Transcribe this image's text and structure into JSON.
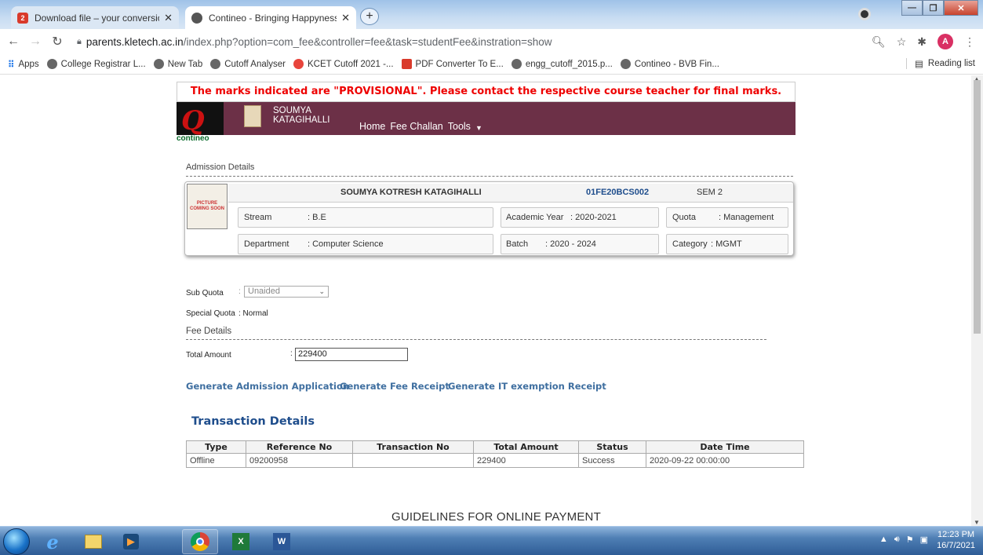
{
  "browser": {
    "tabs": [
      {
        "title": "Download file – your conversion",
        "active": false
      },
      {
        "title": "Contineo - Bringing Happyness t",
        "active": true
      }
    ],
    "url_host": "parents.kletech.ac.in",
    "url_path": "/index.php?option=com_fee&controller=fee&task=studentFee&instration=show",
    "profile_initial": "A",
    "bookmarks": [
      "Apps",
      "College Registrar L...",
      "New Tab",
      "Cutoff Analyser",
      "KCET Cutoff 2021 -...",
      "PDF Converter To E...",
      "engg_cutoff_2015.p...",
      "Contineo - BVB Fin..."
    ],
    "reading_list": "Reading list"
  },
  "page": {
    "notice": "The marks indicated are \"PROVISIONAL\". Please contact the respective course teacher for final marks.",
    "logo_text": "contineo",
    "student_short_name": "SOUMYA KATAGIHALLI",
    "nav": [
      "Home",
      "Fee Challan",
      "Tools"
    ],
    "picture_placeholder": "PICTURE COMING SOON",
    "admission": {
      "section_title": "Admission Details",
      "full_name": "SOUMYA KOTRESH KATAGIHALLI",
      "usn": "01FE20BCS002",
      "semester": "SEM 2",
      "stream_label": "Stream",
      "stream_value": ": B.E",
      "academic_year_label": "Academic Year",
      "academic_year_value": ": 2020-2021",
      "quota_label": "Quota",
      "quota_value": ": Management",
      "department_label": "Department",
      "department_value": ": Computer Science",
      "batch_label": "Batch",
      "batch_value": ": 2020 - 2024",
      "category_label": "Category",
      "category_value": ": MGMT"
    },
    "sub_quota_label": "Sub Quota",
    "sub_quota_value": "Unaided",
    "special_quota_label": "Special Quota",
    "special_quota_value": ": Normal",
    "fee": {
      "section_title": "Fee Details",
      "total_amount_label": "Total Amount",
      "total_amount_value": "229400"
    },
    "links": [
      "Generate Admission Application",
      "Generate Fee Receipt",
      "Generate IT exemption Receipt"
    ],
    "transactions": {
      "title": "Transaction Details",
      "headers": [
        "Type",
        "Reference No",
        "Transaction No",
        "Total Amount",
        "Status",
        "Date Time"
      ],
      "rows": [
        [
          "Offline",
          "09200958",
          "",
          "229400",
          "Success",
          "2020-09-22 00:00:00"
        ]
      ]
    },
    "guidelines_title": "GUIDELINES FOR ONLINE PAYMENT"
  },
  "taskbar": {
    "time": "12:23 PM",
    "date": "16/7/2021"
  }
}
